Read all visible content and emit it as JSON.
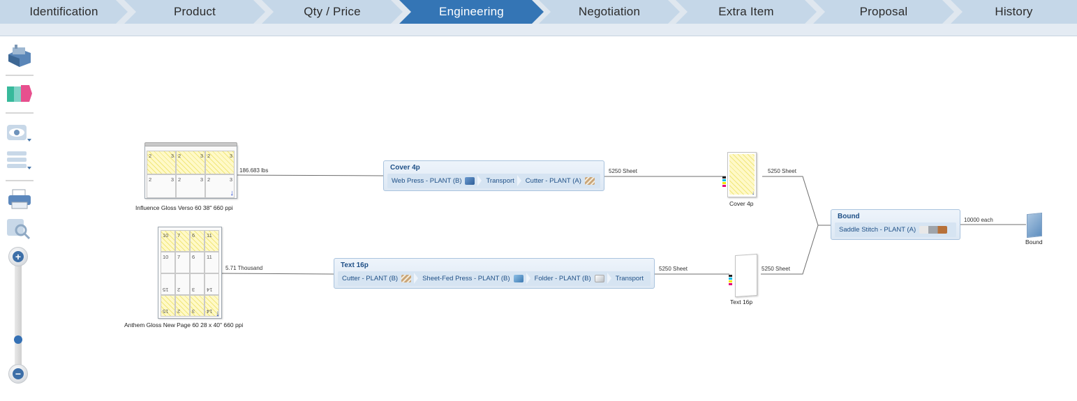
{
  "tabs": [
    {
      "label": "Identification"
    },
    {
      "label": "Product"
    },
    {
      "label": "Qty / Price"
    },
    {
      "label": "Engineering"
    },
    {
      "label": "Negotiation"
    },
    {
      "label": "Extra Item"
    },
    {
      "label": "Proposal"
    },
    {
      "label": "History"
    }
  ],
  "active_tab": "Engineering",
  "toolbar": {
    "icons": [
      "plant-icon",
      "color-swatch-icon",
      "view-eye-icon",
      "list-layout-icon",
      "printer-icon",
      "zoom-search-icon"
    ],
    "zoom_in": "+",
    "zoom_out": "−",
    "zoom_level": 0.12
  },
  "stocks": [
    {
      "caption": "Influence Gloss Verso 60 38\" 660 ppi",
      "qty": "186.683 lbs"
    },
    {
      "caption": "Anthem Gloss New Page 60 28 x 40\" 660 ppi",
      "qty": "5.71 Thousand"
    }
  ],
  "imposition_top": {
    "numbers": [
      "2",
      "3",
      "2",
      "3",
      "2",
      "3",
      "2",
      "3",
      "2",
      "3",
      "2",
      "3"
    ]
  },
  "imposition_bottom": {
    "numbers": [
      "10",
      "7",
      "6",
      "11",
      "10",
      "7",
      "6",
      "11",
      "15",
      "2",
      "3",
      "14",
      "15",
      "2",
      "3",
      "14"
    ]
  },
  "steps": [
    {
      "title": "Cover 4p",
      "operations": [
        {
          "label": "Web Press - PLANT (B)",
          "icon": "press-icon"
        },
        {
          "label": "Transport",
          "icon": ""
        },
        {
          "label": "Cutter - PLANT (A)",
          "icon": "cutter-icon"
        }
      ],
      "out_qty": "5250 Sheet"
    },
    {
      "title": "Text 16p",
      "operations": [
        {
          "label": "Cutter - PLANT (B)",
          "icon": "cutter-icon"
        },
        {
          "label": "Sheet-Fed Press - PLANT (B)",
          "icon": "press-icon"
        },
        {
          "label": "Folder - PLANT (B)",
          "icon": "folder-icon"
        },
        {
          "label": "Transport",
          "icon": ""
        }
      ],
      "out_qty": "5250 Sheet"
    },
    {
      "title": "Bound",
      "operations": [
        {
          "label": "Saddle Stitch - PLANT (A)",
          "icon": "stitch-icon"
        }
      ],
      "out_qty": "10000 each"
    }
  ],
  "components": [
    {
      "caption": "Cover 4p",
      "qty": "5250 Sheet"
    },
    {
      "caption": "Text 16p",
      "qty": "5250 Sheet"
    },
    {
      "caption": "Bound"
    }
  ],
  "colors": {
    "tab_bg": "#c5d7e8",
    "tab_active": "#3475b5",
    "step_text": "#1e4f86"
  }
}
